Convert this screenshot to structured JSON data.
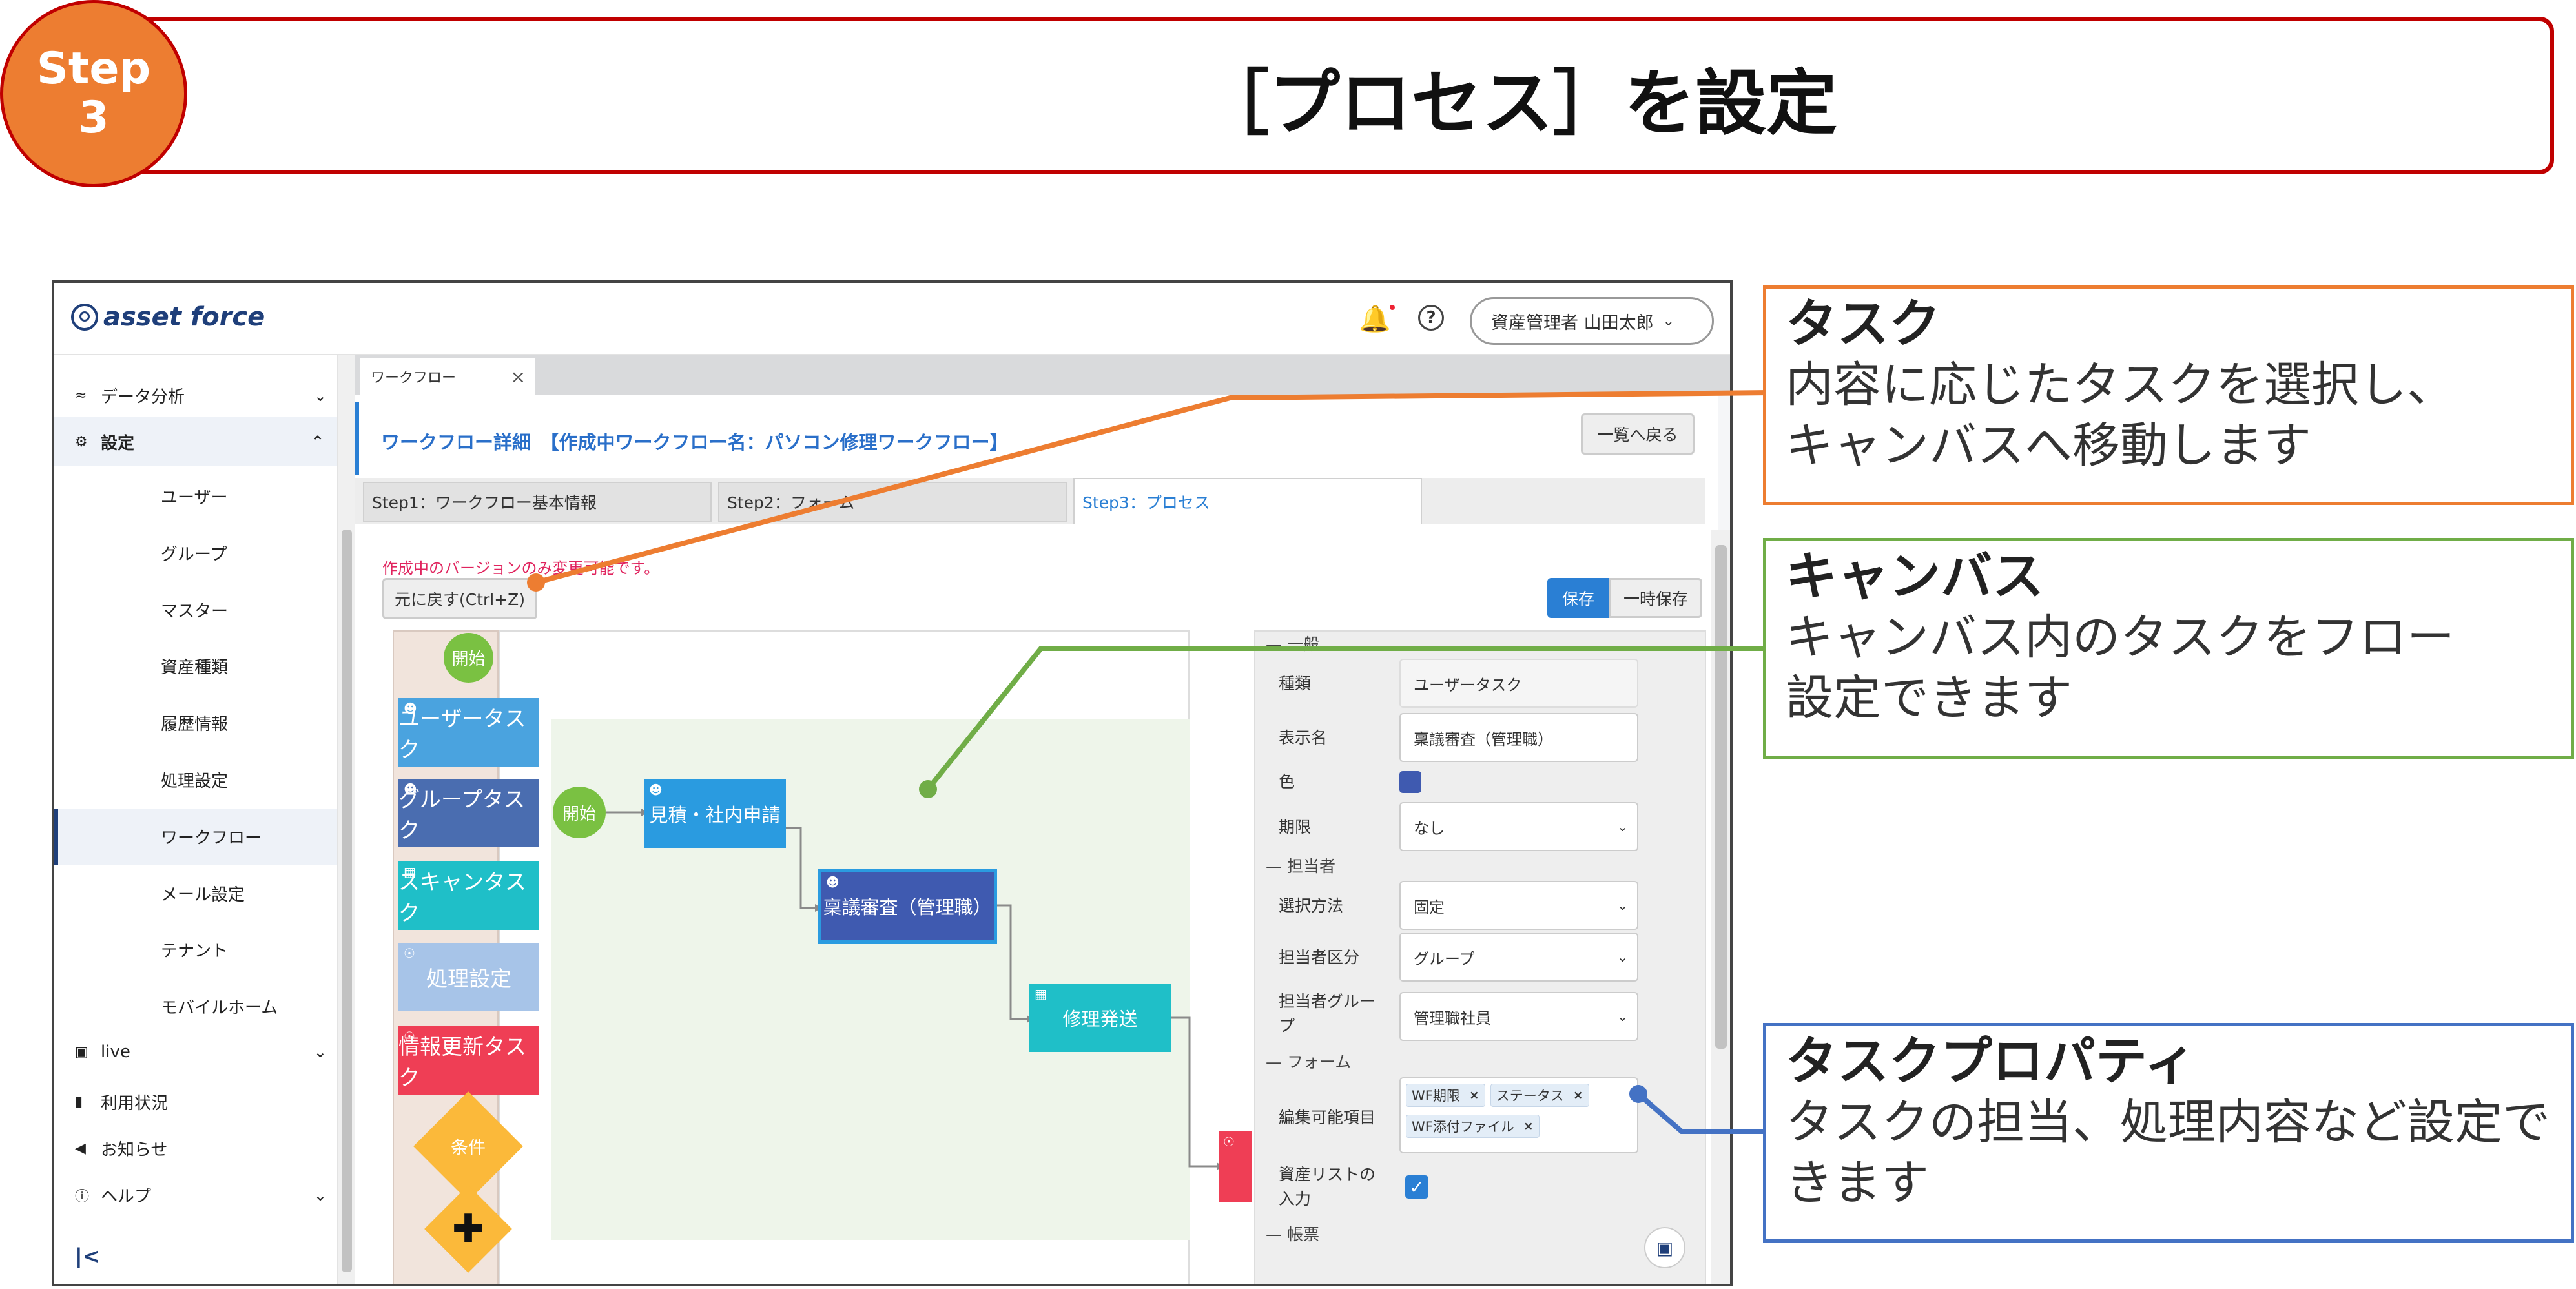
{
  "header": {
    "step_label": "Step",
    "step_number": "3",
    "title": "［プロセス］を設定"
  },
  "callouts": [
    {
      "heading": "タスク",
      "body": [
        "内容に応じたタスクを選択し、",
        "キャンバスへ移動します"
      ],
      "color": "#ed7d31"
    },
    {
      "heading": "キャンバス",
      "body": [
        "キャンバス内のタスクをフロー",
        "設定できます"
      ],
      "color": "#70ad47"
    },
    {
      "heading": "タスクプロパティ",
      "body": [
        "タスクの担当、処理内容など設定で",
        "きます"
      ],
      "color": "#4472c4"
    }
  ],
  "app": {
    "logo": "asset force",
    "user_menu": "資産管理者 山田太郎",
    "sidebar": {
      "groups": [
        {
          "label": "データ分析"
        },
        {
          "label": "設定"
        }
      ],
      "settings_items": [
        "ユーザー",
        "グループ",
        "マスター",
        "資産種類",
        "履歴情報",
        "処理設定",
        "ワークフロー",
        "メール設定",
        "テナント",
        "モバイルホーム"
      ],
      "bottom": [
        {
          "label": "live"
        },
        {
          "label": "利用状況"
        },
        {
          "label": "お知らせ"
        },
        {
          "label": "ヘルプ"
        }
      ]
    },
    "tab": "ワークフロー",
    "page_title": "ワークフロー詳細　【作成中ワークフロー名：パソコン修理ワークフロー】",
    "back_button": "一覧へ戻る",
    "steps": [
      "Step1：ワークフロー基本情報",
      "Step2：フォーム",
      "Step3：プロセス"
    ],
    "notice": "作成中のバージョンのみ変更可能です。",
    "undo_button": "元に戻す(Ctrl+Z)",
    "save_button": "保存",
    "temp_save_button": "一時保存",
    "palette": [
      {
        "label": "開始",
        "color": "#7ac142"
      },
      {
        "label": "ユーザータスク",
        "color": "#4aa3df"
      },
      {
        "label": "グループタスク",
        "color": "#4a6db0"
      },
      {
        "label": "スキャンタスク",
        "color": "#1fbfc8"
      },
      {
        "label": "処理設定",
        "color": "#a7c4e8"
      },
      {
        "label": "情報更新タスク",
        "color": "#ef3e55"
      },
      {
        "label": "条件",
        "color": "#fbb93a"
      }
    ],
    "canvas": {
      "nodes": [
        {
          "label": "開始",
          "color": "#7ac142"
        },
        {
          "label": "見積・社内申請",
          "color": "#2a9be0"
        },
        {
          "label": "稟議審査（管理職）",
          "color": "#3f5ab0"
        },
        {
          "label": "修理発送",
          "color": "#1fbfc8"
        }
      ]
    },
    "properties": {
      "section_general": "一般",
      "type_label": "種類",
      "type_value": "ユーザータスク",
      "display_label": "表示名",
      "display_value": "稟議審査（管理職）",
      "color_label": "色",
      "color_value": "#3f5ab0",
      "deadline_label": "期限",
      "deadline_value": "なし",
      "section_assignee": "担当者",
      "method_label": "選択方法",
      "method_value": "固定",
      "assignee_type_label": "担当者区分",
      "assignee_type_value": "グループ",
      "assignee_group_label": [
        "担当者グルー",
        "プ"
      ],
      "assignee_group_value": "管理職社員",
      "section_form": "フォーム",
      "editable_label": "編集可能項目",
      "editable_tags": [
        "WF期限",
        "ステータス",
        "WF添付ファイル"
      ],
      "asset_list_label": [
        "資産リストの",
        "入力"
      ],
      "section_report": "帳票"
    }
  }
}
